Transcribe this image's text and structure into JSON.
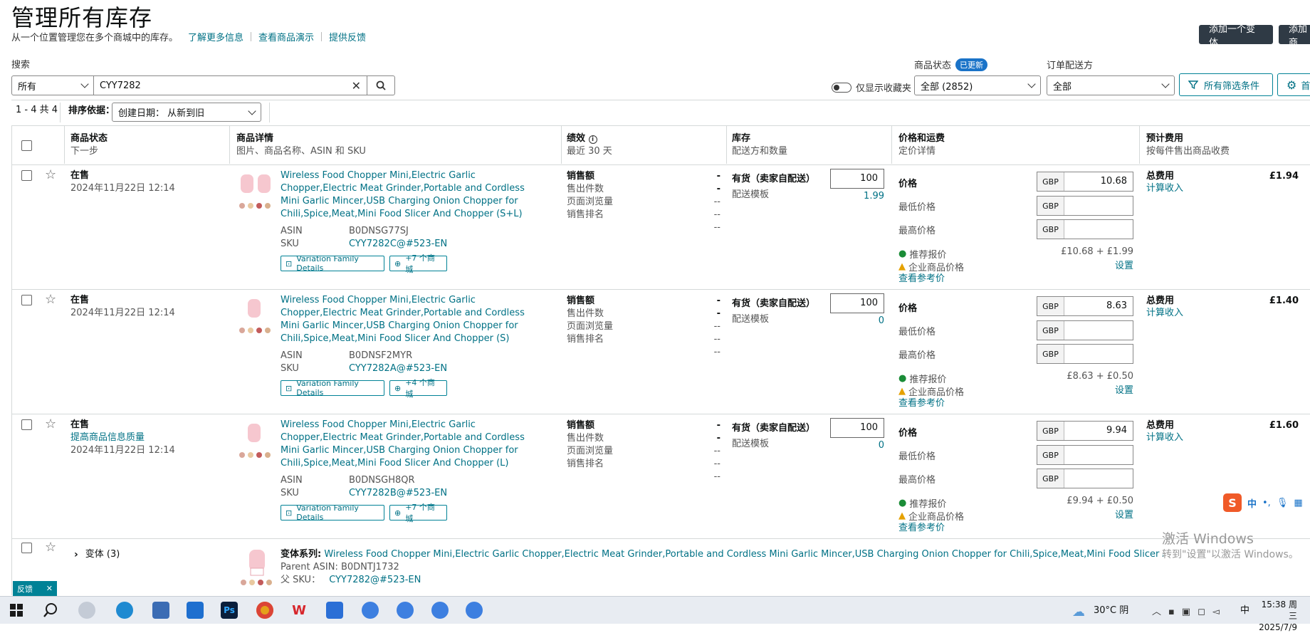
{
  "header": {
    "title": "管理所有库存",
    "subtitle": "从一个位置管理您在多个商城中的库存。",
    "links": [
      "了解更多信息",
      "查看商品演示",
      "提供反馈"
    ],
    "add_variant": "添加一个变体",
    "add_product": "添加商"
  },
  "filters": {
    "search_label": "搜索",
    "scope": "所有",
    "search_value": "CYY7282",
    "status_label": "商品状态",
    "status_badge": "已更新",
    "status_value": "全部 (2852)",
    "fulfil_label": "订单配送方",
    "fulfil_value": "全部",
    "fav_toggle": "仅显示收藏夹",
    "all_filters": "所有筛选条件",
    "settings_partial": "首"
  },
  "list": {
    "count": "1 - 4 共 4",
    "sort_label": "排序依据：",
    "sort_value": "创建日期： 从新到旧"
  },
  "columns": [
    {
      "t": "商品状态",
      "s": "下一步"
    },
    {
      "t": "商品详情",
      "s": "图片、商品名称、ASIN 和 SKU"
    },
    {
      "t": "绩效",
      "s": "最近 30 天"
    },
    {
      "t": "库存",
      "s": "配送方和数量"
    },
    {
      "t": "价格和运费",
      "s": "定价详情"
    },
    {
      "t": "预计费用",
      "s": "按每件售出商品收费"
    }
  ],
  "rows": [
    {
      "status": "在售",
      "next": "",
      "date": "2024年11月22日 12:14",
      "title": "Wireless Food Chopper Mini,Electric Garlic Chopper,Electric Meat Grinder,Portable and Cordless Mini Garlic Mincer,USB Charging Onion Chopper for Chili,Spice,Meat,Mini Food Slicer And Chopper (S+L)",
      "asin_label": "ASIN",
      "asin": "B0DNSG77SJ",
      "sku_label": "SKU",
      "sku": "CYY7282C@#523-EN",
      "chip1": "Variation Family Details",
      "chip2": "+7 个商城",
      "perf": [
        "销售额",
        "售出件数",
        "页面浏览量",
        "销售排名"
      ],
      "dashes": [
        "--",
        "--",
        "--",
        "--"
      ],
      "stock": "有货（卖家自配送）",
      "qty": "100",
      "tmpl": "配送模板",
      "tmpl_val": "1.99",
      "price_label": "价格",
      "min_label": "最低价格",
      "max_label": "最高价格",
      "cur": "GBP",
      "price": "10.68",
      "rec": "推荐报价",
      "rec_val": "£10.68 + £1.99",
      "biz": "企业商品价格",
      "biz_link": "设置",
      "ref": "查看参考价",
      "fee_label": "总费用",
      "fee_link": "计算收入",
      "fee": "£1.94"
    },
    {
      "status": "在售",
      "next": "",
      "date": "2024年11月22日 12:14",
      "title": "Wireless Food Chopper Mini,Electric Garlic Chopper,Electric Meat Grinder,Portable and Cordless Mini Garlic Mincer,USB Charging Onion Chopper for Chili,Spice,Meat,Mini Food Slicer And Chopper (S)",
      "asin_label": "ASIN",
      "asin": "B0DNSF2MYR",
      "sku_label": "SKU",
      "sku": "CYY7282A@#523-EN",
      "chip1": "Variation Family Details",
      "chip2": "+4 个商城",
      "perf": [
        "销售额",
        "售出件数",
        "页面浏览量",
        "销售排名"
      ],
      "dashes": [
        "--",
        "--",
        "--",
        "--"
      ],
      "stock": "有货（卖家自配送）",
      "qty": "100",
      "tmpl": "配送模板",
      "tmpl_val": "0",
      "price_label": "价格",
      "min_label": "最低价格",
      "max_label": "最高价格",
      "cur": "GBP",
      "price": "8.63",
      "rec": "推荐报价",
      "rec_val": "£8.63 + £0.50",
      "biz": "企业商品价格",
      "biz_link": "设置",
      "ref": "查看参考价",
      "fee_label": "总费用",
      "fee_link": "计算收入",
      "fee": "£1.40"
    },
    {
      "status": "在售",
      "next": "提高商品信息质量",
      "date": "2024年11月22日 12:14",
      "title": "Wireless Food Chopper Mini,Electric Garlic Chopper,Electric Meat Grinder,Portable and Cordless Mini Garlic Mincer,USB Charging Onion Chopper for Chili,Spice,Meat,Mini Food Slicer And Chopper (L)",
      "asin_label": "ASIN",
      "asin": "B0DNSGH8QR",
      "sku_label": "SKU",
      "sku": "CYY7282B@#523-EN",
      "chip1": "Variation Family Details",
      "chip2": "+7 个商城",
      "perf": [
        "销售额",
        "售出件数",
        "页面浏览量",
        "销售排名"
      ],
      "dashes": [
        "--",
        "--",
        "--",
        "--"
      ],
      "stock": "有货（卖家自配送）",
      "qty": "100",
      "tmpl": "配送模板",
      "tmpl_val": "0",
      "price_label": "价格",
      "min_label": "最低价格",
      "max_label": "最高价格",
      "cur": "GBP",
      "price": "9.94",
      "rec": "推荐报价",
      "rec_val": "£9.94 + £0.50",
      "biz": "企业商品价格",
      "biz_link": "设置",
      "ref": "查看参考价",
      "fee_label": "总费用",
      "fee_link": "计算收入",
      "fee": "£1.60"
    }
  ],
  "parent": {
    "variants": "变体 (3)",
    "family_label": "变体系列:",
    "family": "Wireless Food Chopper Mini,Electric Garlic Chopper,Electric Meat Grinder,Portable and Cordless Mini Garlic Mincer,USB Charging Onion Chopper for Chili,Spice,Meat,Mini Food Slicer And Chopper",
    "asin_label": "Parent ASIN:",
    "asin": "B0DNTJ1732",
    "sku_label": "父 SKU：",
    "sku": "CYY7282@#523-EN"
  },
  "feedback": "反馈",
  "watermark": {
    "line1": "激活 Windows",
    "line2": "转到\"设置\"以激活 Windows。"
  },
  "ime": "中",
  "taskbar": {
    "weather": "30°C 阴",
    "ime": "中",
    "time": "15:38 周三",
    "date": "2025/7/9"
  }
}
